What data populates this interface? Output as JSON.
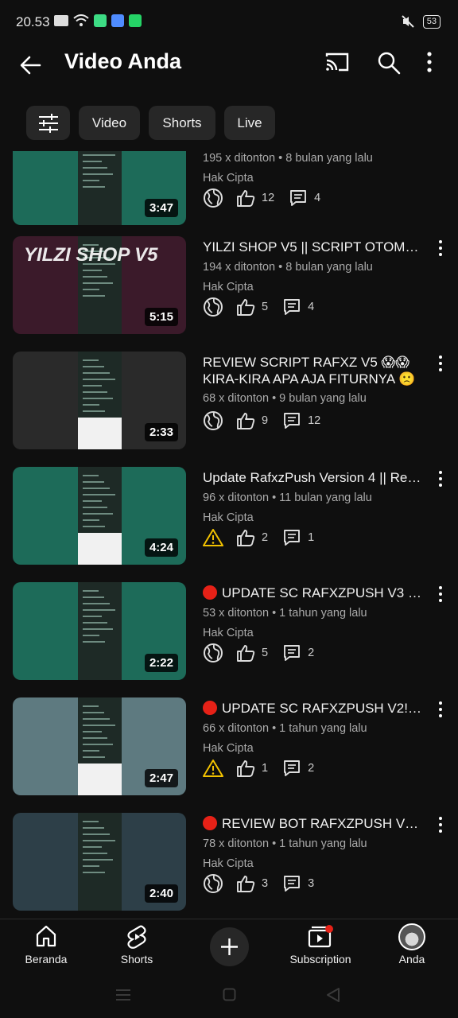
{
  "status": {
    "time": "20.53",
    "battery": "53"
  },
  "appbar": {
    "title": "Video Anda"
  },
  "chips": [
    "Video",
    "Shorts",
    "Live"
  ],
  "videos": [
    {
      "title": "",
      "meta": "195 x ditonton • 8 bulan yang lalu",
      "license": "Hak Cipta",
      "visibility": "public",
      "likes": "12",
      "comments": "4",
      "duration": "3:47",
      "thumb_color": "#1d6b59"
    },
    {
      "title": "YILZI SHOP V5 || SCRIPT OTOMATIS...",
      "meta": "194 x ditonton • 8 bulan yang lalu",
      "license": "Hak Cipta",
      "visibility": "public",
      "likes": "5",
      "comments": "4",
      "duration": "5:15",
      "thumb_color": "#3b1a2a",
      "thumb_text": "YILZI SHOP V5"
    },
    {
      "title": "REVIEW SCRIPT RAFXZ V5 😱😱 KIRA-KIRA APA AJA FITURNYA 🙁🙁",
      "meta": "68 x ditonton • 9 bulan yang lalu",
      "license": "",
      "visibility": "public",
      "likes": "9",
      "comments": "12",
      "duration": "2:33",
      "thumb_color": "#2a2a2a"
    },
    {
      "title": "Update RafxzPush Version 4 || Revie...",
      "meta": "96 x ditonton • 11 bulan yang lalu",
      "license": "Hak Cipta",
      "visibility": "warning",
      "likes": "2",
      "comments": "1",
      "duration": "4:24",
      "thumb_color": "#1d6b59"
    },
    {
      "title": "UPDATE SC RAFXZPUSH V3 WOI...",
      "red_dot": true,
      "meta": "53 x ditonton • 1 tahun yang lalu",
      "license": "Hak Cipta",
      "visibility": "public",
      "likes": "5",
      "comments": "2",
      "duration": "2:22",
      "thumb_color": "#1d6b59"
    },
    {
      "title": "UPDATE SC RAFXZPUSH V2!?? || ...",
      "red_dot": true,
      "meta": "66 x ditonton • 1 tahun yang lalu",
      "license": "Hak Cipta",
      "visibility": "warning",
      "likes": "1",
      "comments": "2",
      "duration": "2:47",
      "thumb_color": "#5e7a80"
    },
    {
      "title": "REVIEW BOT RAFXZPUSH V1 CO...",
      "red_dot": true,
      "meta": "78 x ditonton • 1 tahun yang lalu",
      "license": "Hak Cipta",
      "visibility": "public",
      "likes": "3",
      "comments": "3",
      "duration": "2:40",
      "thumb_color": "#2d3f48"
    }
  ],
  "nav": [
    {
      "label": "Beranda",
      "icon": "home-icon"
    },
    {
      "label": "Shorts",
      "icon": "shorts-icon"
    },
    {
      "label": "",
      "icon": "create-icon"
    },
    {
      "label": "Subscription",
      "icon": "subscriptions-icon"
    },
    {
      "label": "Anda",
      "icon": "avatar"
    }
  ]
}
